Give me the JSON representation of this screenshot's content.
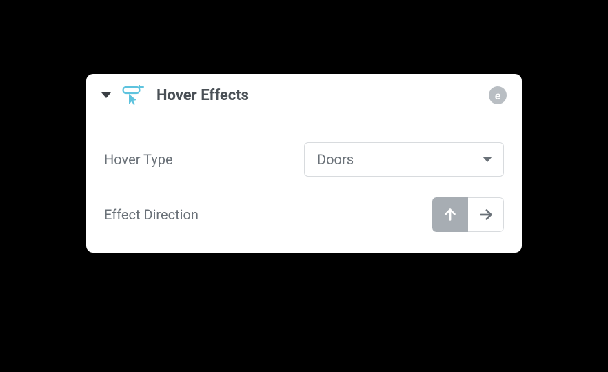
{
  "panel": {
    "title": "Hover Effects",
    "brand_letter": "e"
  },
  "fields": {
    "hover_type": {
      "label": "Hover Type",
      "value": "Doors"
    },
    "effect_direction": {
      "label": "Effect Direction",
      "options": [
        "up",
        "right"
      ],
      "selected": "up"
    }
  }
}
